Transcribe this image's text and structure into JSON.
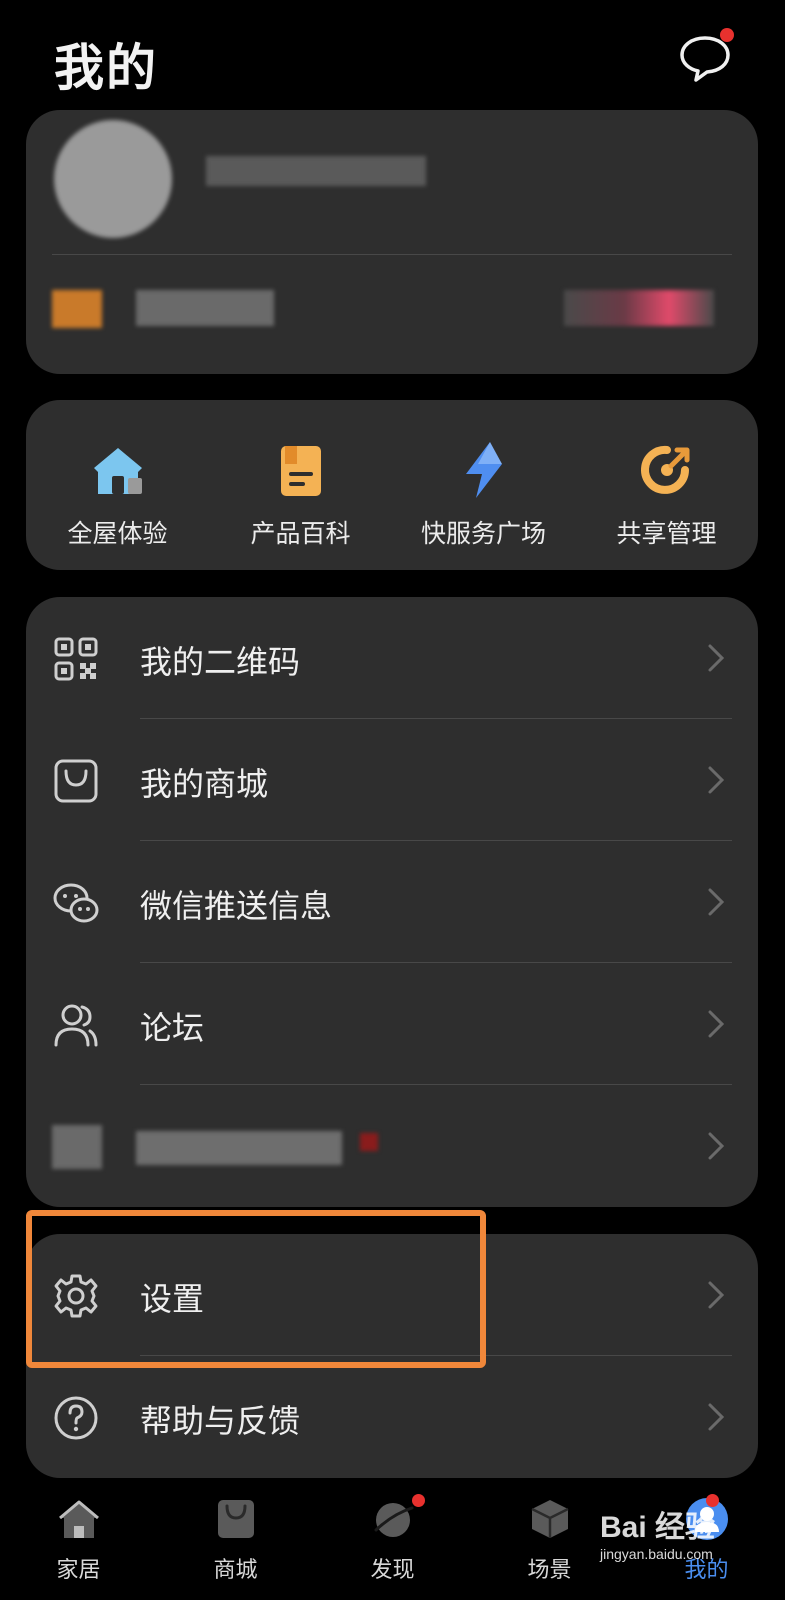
{
  "header": {
    "title": "我的"
  },
  "quick_actions": [
    {
      "label": "全屋体验",
      "icon": "house-icon"
    },
    {
      "label": "产品百科",
      "icon": "book-icon"
    },
    {
      "label": "快服务广场",
      "icon": "lightning-icon"
    },
    {
      "label": "共享管理",
      "icon": "share-icon"
    }
  ],
  "menu": [
    {
      "label": "我的二维码",
      "icon": "qr-code-icon"
    },
    {
      "label": "我的商城",
      "icon": "shopping-bag-icon"
    },
    {
      "label": "微信推送信息",
      "icon": "wechat-icon"
    },
    {
      "label": "论坛",
      "icon": "people-icon"
    }
  ],
  "settings_menu": [
    {
      "label": "设置",
      "icon": "gear-icon"
    },
    {
      "label": "帮助与反馈",
      "icon": "help-icon"
    }
  ],
  "tabs": [
    {
      "label": "家居",
      "icon": "home-icon"
    },
    {
      "label": "商城",
      "icon": "shop-bag-icon"
    },
    {
      "label": "发现",
      "icon": "planet-icon",
      "badge": true
    },
    {
      "label": "场景",
      "icon": "cube-icon"
    },
    {
      "label": "我的",
      "icon": "profile-avatar-icon",
      "badge": true,
      "active": true
    }
  ],
  "watermark": {
    "main": "Bai 经验",
    "sub": "jingyan.baidu.com"
  },
  "colors": {
    "accent_highlight": "#f0873a",
    "badge_red": "#e8312e",
    "card_bg": "#2e2e2e"
  }
}
